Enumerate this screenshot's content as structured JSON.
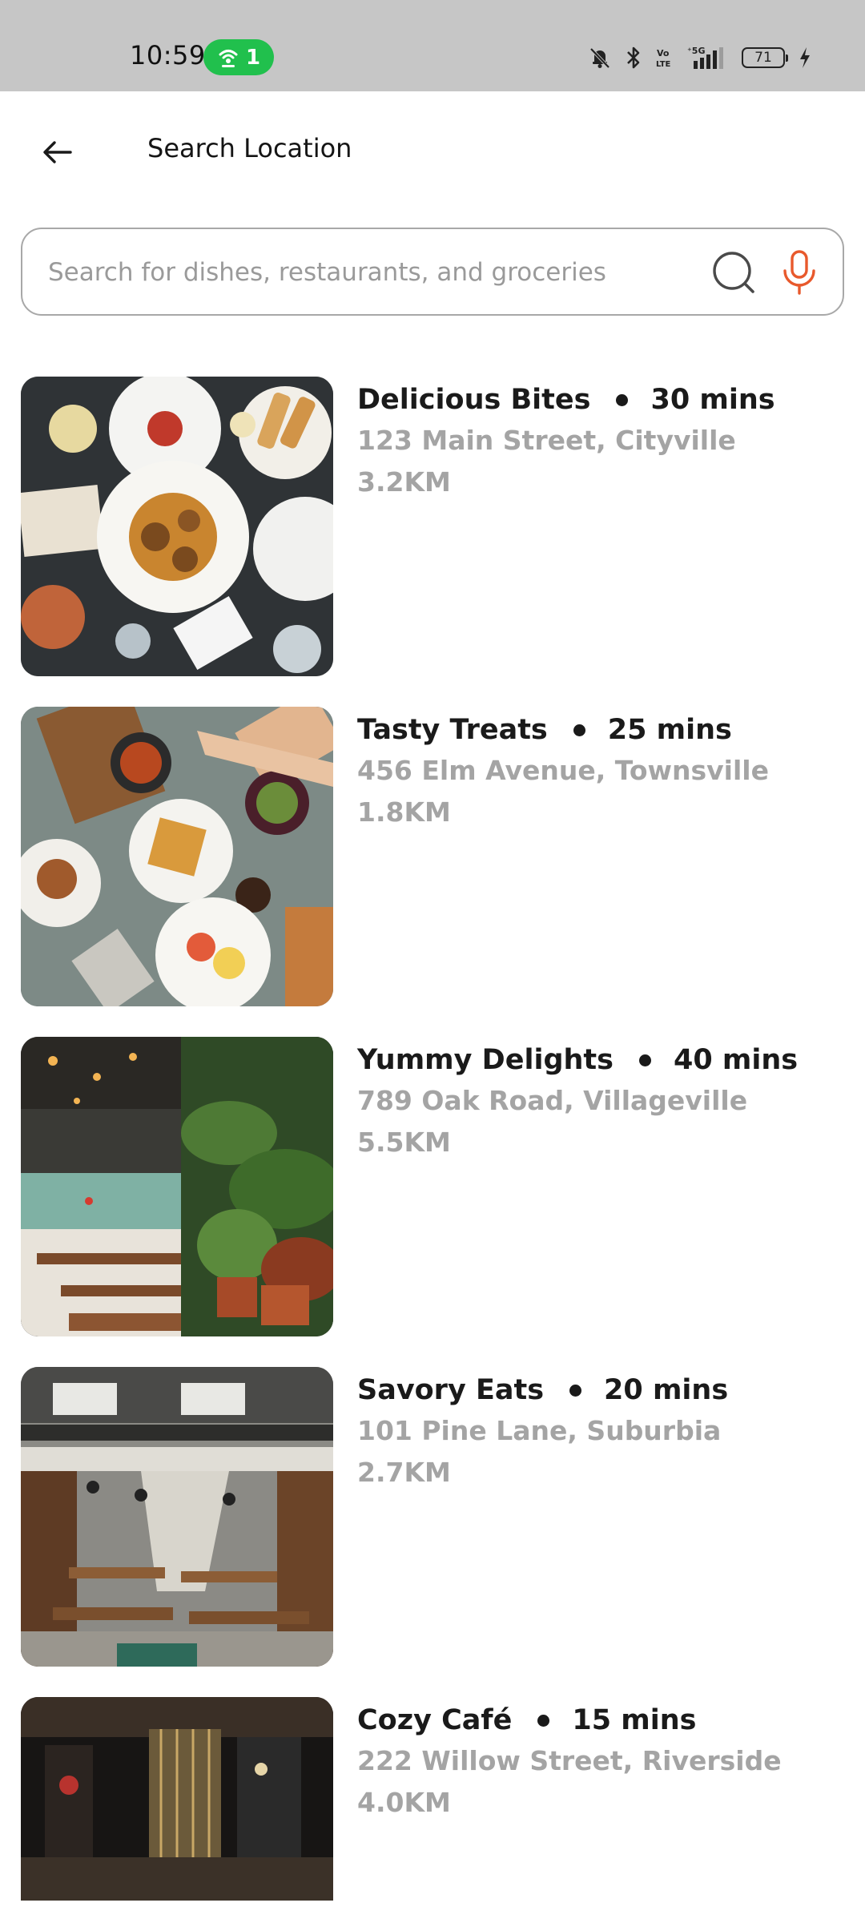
{
  "status_bar": {
    "time": "10:59",
    "hotspot_count": "1",
    "network_label": "5G",
    "volte_label": "Vo LTE",
    "battery_level": "71",
    "icons": [
      "hotspot-icon",
      "mute-icon",
      "bluetooth-icon",
      "volte-icon",
      "signal-icon",
      "battery-icon",
      "charging-icon"
    ]
  },
  "header": {
    "title": "Search Location",
    "back_icon": "arrow-left-icon"
  },
  "search": {
    "placeholder": "Search for dishes, restaurants, and groceries",
    "value": "",
    "search_icon": "magnifier-icon",
    "mic_icon": "microphone-icon"
  },
  "colors": {
    "accent": "#e8592c",
    "status_green": "#21c04d",
    "status_bar_bg": "#c6c6c6",
    "secondary_text": "#a4a4a4"
  },
  "restaurants": [
    {
      "name": "Delicious Bites",
      "time": "30 mins",
      "address": "123 Main Street, Cityville",
      "distance": "3.2KM"
    },
    {
      "name": "Tasty Treats",
      "time": "25 mins",
      "address": "456 Elm Avenue, Townsville",
      "distance": "1.8KM"
    },
    {
      "name": "Yummy Delights",
      "time": "40 mins",
      "address": "789 Oak Road, Villageville",
      "distance": "5.5KM"
    },
    {
      "name": "Savory Eats",
      "time": "20 mins",
      "address": "101 Pine Lane, Suburbia",
      "distance": "2.7KM"
    },
    {
      "name": "Cozy Café",
      "time": "15 mins",
      "address": "222 Willow Street, Riverside",
      "distance": "4.0KM"
    }
  ]
}
